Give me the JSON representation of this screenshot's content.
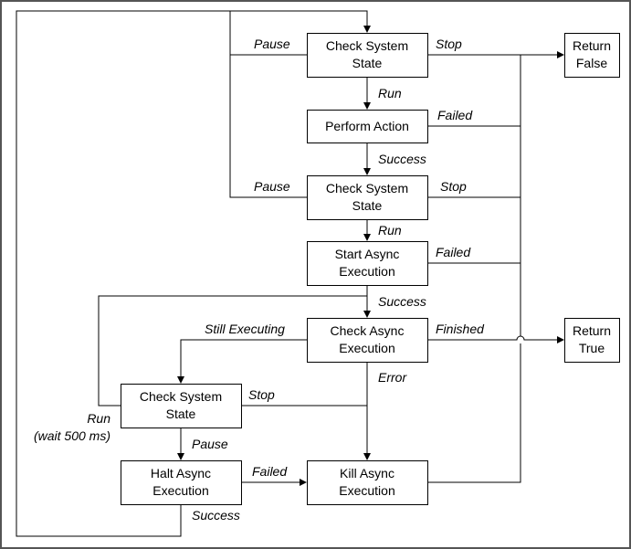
{
  "diagram": {
    "type": "flowchart",
    "nodes": [
      {
        "id": "check1",
        "lines": [
          "Check System",
          "State"
        ]
      },
      {
        "id": "perform",
        "lines": [
          "Perform Action"
        ]
      },
      {
        "id": "check2",
        "lines": [
          "Check System",
          "State"
        ]
      },
      {
        "id": "start_async",
        "lines": [
          "Start Async",
          "Execution"
        ]
      },
      {
        "id": "check_async",
        "lines": [
          "Check Async",
          "Execution"
        ]
      },
      {
        "id": "check3",
        "lines": [
          "Check System",
          "State"
        ]
      },
      {
        "id": "halt_async",
        "lines": [
          "Halt Async",
          "Execution"
        ]
      },
      {
        "id": "kill_async",
        "lines": [
          "Kill Async",
          "Execution"
        ]
      },
      {
        "id": "return_false",
        "lines": [
          "Return",
          "False"
        ]
      },
      {
        "id": "return_true",
        "lines": [
          "Return",
          "True"
        ]
      }
    ],
    "edges": [
      {
        "from": "check1",
        "to": "check1",
        "label": "Pause"
      },
      {
        "from": "check1",
        "to": "return_false",
        "label": "Stop"
      },
      {
        "from": "check1",
        "to": "perform",
        "label": "Run"
      },
      {
        "from": "perform",
        "to": "return_false",
        "label": "Failed"
      },
      {
        "from": "perform",
        "to": "check2",
        "label": "Success"
      },
      {
        "from": "check2",
        "to": "check1",
        "label": "Pause"
      },
      {
        "from": "check2",
        "to": "return_false",
        "label": "Stop"
      },
      {
        "from": "check2",
        "to": "start_async",
        "label": "Run"
      },
      {
        "from": "start_async",
        "to": "return_false",
        "label": "Failed"
      },
      {
        "from": "start_async",
        "to": "check_async",
        "label": "Success"
      },
      {
        "from": "check_async",
        "to": "check3",
        "label": "Still Executing"
      },
      {
        "from": "check_async",
        "to": "return_true",
        "label": "Finished"
      },
      {
        "from": "check_async",
        "to": "kill_async",
        "label": "Error"
      },
      {
        "from": "check3",
        "to": "kill_async",
        "label": "Stop"
      },
      {
        "from": "check3",
        "to": "check_async",
        "label": "Run",
        "label2": "(wait 500 ms)"
      },
      {
        "from": "check3",
        "to": "halt_async",
        "label": "Pause"
      },
      {
        "from": "halt_async",
        "to": "kill_async",
        "label": "Failed"
      },
      {
        "from": "halt_async",
        "to": "check1",
        "label": "Success"
      },
      {
        "from": "kill_async",
        "to": "return_false",
        "label": ""
      }
    ]
  }
}
